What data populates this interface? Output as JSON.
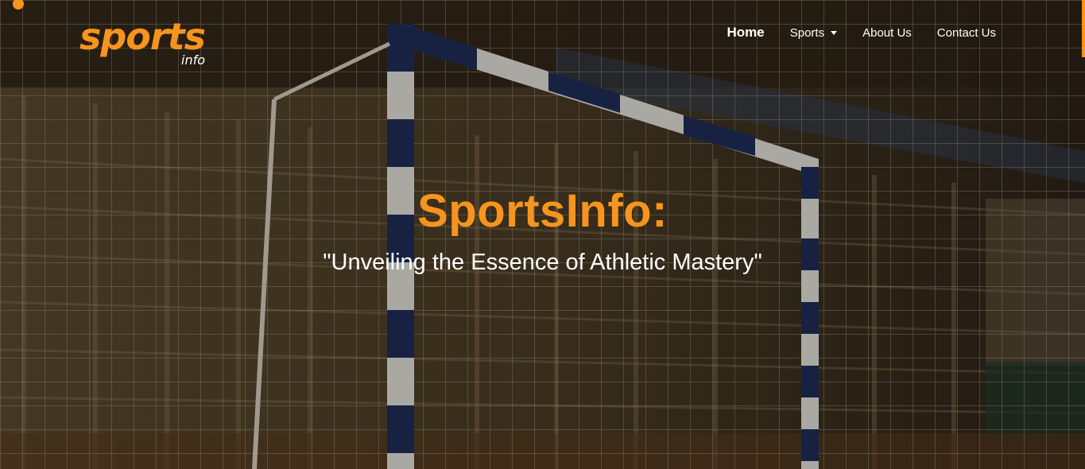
{
  "brand": {
    "logo_main": "sports",
    "logo_sub": "info",
    "accent_color": "#f7941d"
  },
  "nav": {
    "items": [
      {
        "label": "Home",
        "active": true
      },
      {
        "label": "Sports",
        "dropdown": true
      },
      {
        "label": "About Us"
      },
      {
        "label": "Contact Us"
      }
    ]
  },
  "hero": {
    "title": "SportsInfo:",
    "subtitle": "\"Unveiling the Essence of Athletic Mastery\"",
    "background": "indoor-handball-goal-net-photo"
  }
}
